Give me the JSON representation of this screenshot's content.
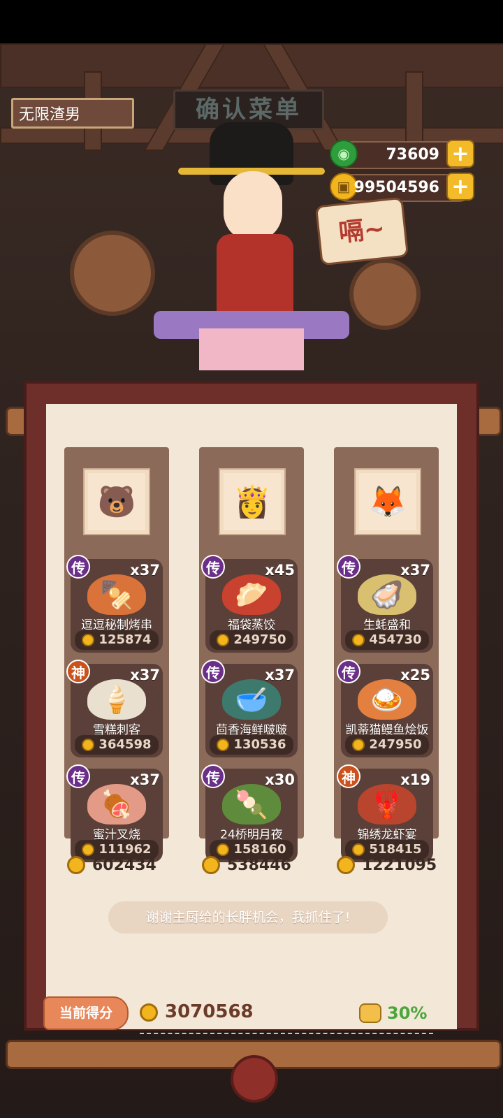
{
  "header": {
    "player_name": "无限渣男",
    "sign_title": "确认菜单",
    "jade_amount": "73609",
    "coin_amount": "99504596"
  },
  "judge": {
    "speech": "嗝~"
  },
  "columns": [
    {
      "avatar_icon": "bear-chef-avatar",
      "items": [
        {
          "rank": "传",
          "qty": "x37",
          "name": "逗逗秘制烤串",
          "price": "125874",
          "icon": "skewer-dish-icon"
        },
        {
          "rank": "神",
          "qty": "x37",
          "name": "雪糕刺客",
          "price": "364598",
          "icon": "ice-cream-dish-icon"
        },
        {
          "rank": "传",
          "qty": "x37",
          "name": "蜜汁叉烧",
          "price": "111962",
          "icon": "char-siu-dish-icon"
        }
      ],
      "total": "602434"
    },
    {
      "avatar_icon": "princess-chef-avatar",
      "items": [
        {
          "rank": "传",
          "qty": "x45",
          "name": "福袋蒸饺",
          "price": "249750",
          "icon": "dumpling-dish-icon"
        },
        {
          "rank": "传",
          "qty": "x37",
          "name": "茴香海鲜啵啵",
          "price": "130536",
          "icon": "seafood-bowl-icon"
        },
        {
          "rank": "传",
          "qty": "x30",
          "name": "24桥明月夜",
          "price": "158160",
          "icon": "moon-dish-icon"
        }
      ],
      "total": "538446"
    },
    {
      "avatar_icon": "fox-chef-avatar",
      "items": [
        {
          "rank": "传",
          "qty": "x37",
          "name": "生蚝盛和",
          "price": "454730",
          "icon": "oyster-dish-icon"
        },
        {
          "rank": "传",
          "qty": "x25",
          "name": "凯蒂猫鳗鱼烩饭",
          "price": "247950",
          "icon": "eel-rice-dish-icon"
        },
        {
          "rank": "神",
          "qty": "x19",
          "name": "锦绣龙虾宴",
          "price": "518415",
          "icon": "lobster-feast-icon"
        }
      ],
      "total": "1221095"
    }
  ],
  "message": "谢谢主厨给的长胖机会，我抓住了!",
  "footer": {
    "score_label": "当前得分",
    "score_value": "3070568",
    "bonus": "30%"
  },
  "colors": {
    "scroll_paper": "#f3e7d7",
    "item_bg": "#5a4038",
    "legend_badge": "#6b2f8a",
    "god_badge": "#c9521d",
    "bonus_green": "#4aa63a"
  }
}
